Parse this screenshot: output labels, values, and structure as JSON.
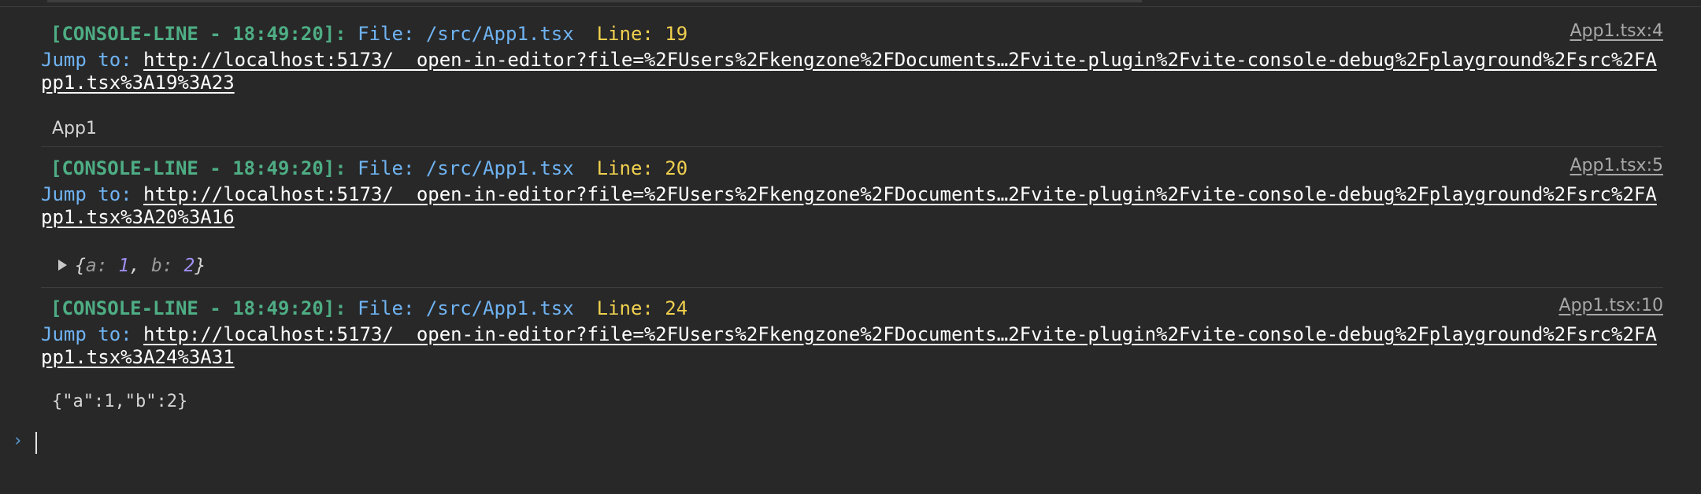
{
  "entries": [
    {
      "tag": "[CONSOLE-LINE - 18:49:20]:",
      "file_label": "File:",
      "file_path": "/src/App1.tsx",
      "line_label": "Line:",
      "line_num": "19",
      "jump_label": "Jump to:",
      "jump_url": "http://localhost:5173/__open-in-editor?file=%2FUsers%2Fkengzone%2FDocuments…2Fvite-plugin%2Fvite-console-debug%2Fplayground%2Fsrc%2FApp1.tsx%3A19%3A23",
      "source": "App1.tsx:4",
      "message": "App1"
    },
    {
      "tag": "[CONSOLE-LINE - 18:49:20]:",
      "file_label": "File:",
      "file_path": "/src/App1.tsx",
      "line_label": "Line:",
      "line_num": "20",
      "jump_label": "Jump to:",
      "jump_url": "http://localhost:5173/__open-in-editor?file=%2FUsers%2Fkengzone%2FDocuments…2Fvite-plugin%2Fvite-console-debug%2Fplayground%2Fsrc%2FApp1.tsx%3A20%3A16",
      "source": "App1.tsx:5",
      "object_preview": {
        "open": "{",
        "key_a": "a",
        "val_a": "1",
        "key_b": "b",
        "val_b": "2",
        "close": "}"
      }
    },
    {
      "tag": "[CONSOLE-LINE - 18:49:20]:",
      "file_label": "File:",
      "file_path": "/src/App1.tsx",
      "line_label": "Line:",
      "line_num": "24",
      "jump_label": "Jump to:",
      "jump_url": "http://localhost:5173/__open-in-editor?file=%2FUsers%2Fkengzone%2FDocuments…2Fvite-plugin%2Fvite-console-debug%2Fplayground%2Fsrc%2FApp1.tsx%3A24%3A31",
      "source": "App1.tsx:10",
      "message": "{\"a\":1,\"b\":2}"
    }
  ],
  "prompt_symbol": "›",
  "colors": {
    "background": "#282828",
    "tag": "#4ead84",
    "file": "#6fb3f2",
    "line": "#f0d04f",
    "link": "#ffffff",
    "number": "#9f8ff3"
  },
  "icons": {
    "expand": "triangle-right-icon",
    "prompt": "chevron-right-icon"
  }
}
